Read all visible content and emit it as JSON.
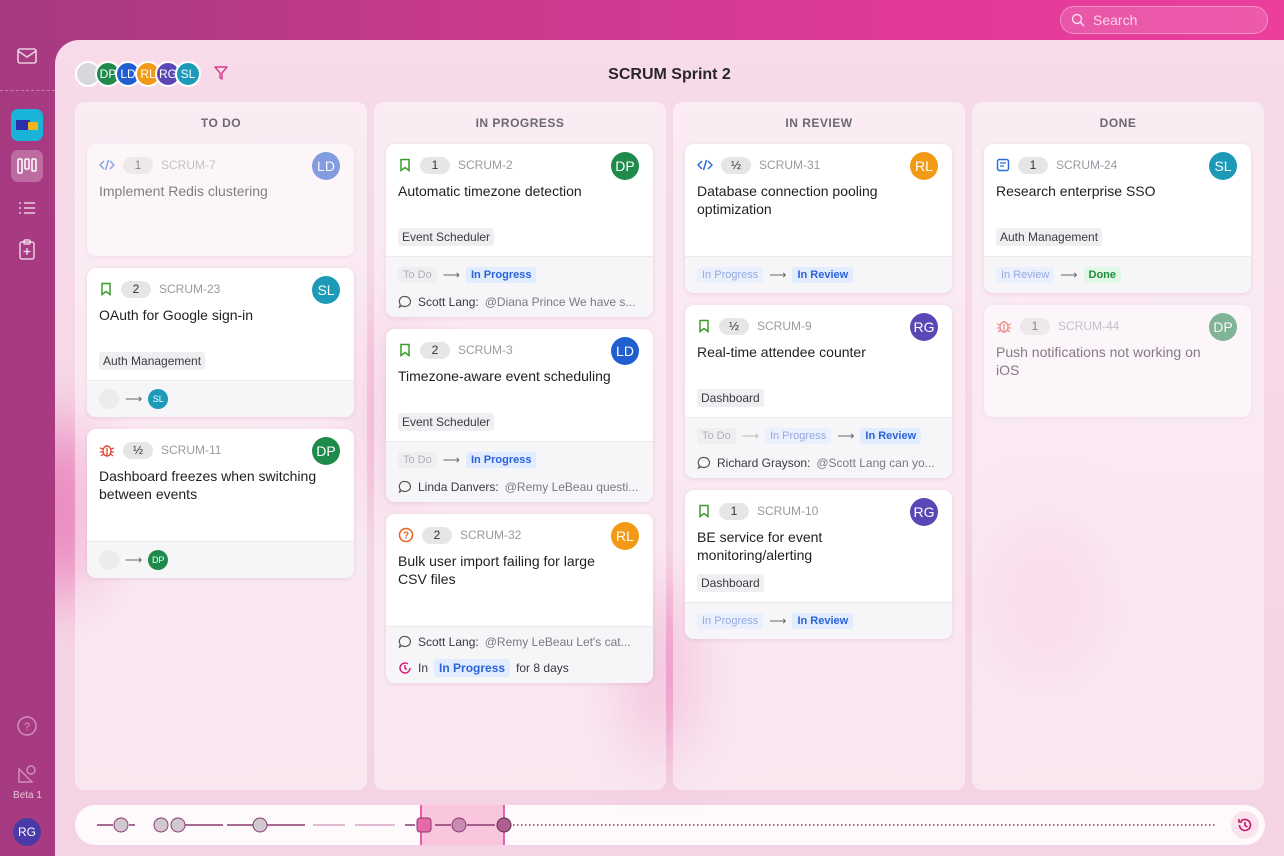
{
  "search": {
    "placeholder": "Search"
  },
  "sidebar": {
    "beta_label": "Beta 1",
    "user_initials": "RG"
  },
  "board": {
    "title": "SCRUM Sprint 2",
    "members": [
      {
        "initials": "",
        "color": "#d8d8dc"
      },
      {
        "initials": "DP",
        "color": "#1e8a4c"
      },
      {
        "initials": "LD",
        "color": "#1f5fd1"
      },
      {
        "initials": "RL",
        "color": "#f29a16"
      },
      {
        "initials": "RG",
        "color": "#5a47b5"
      },
      {
        "initials": "SL",
        "color": "#1d9ab8"
      }
    ]
  },
  "columns": [
    {
      "title": "TO DO",
      "cards": [
        {
          "type": "code-icon",
          "points": "1",
          "key": "SCRUM-7",
          "title": "Implement Redis clustering",
          "tag": "",
          "avatar": {
            "initials": "LD",
            "color": "#1f5fd1"
          },
          "faded": true
        },
        {
          "type": "bookmark-icon",
          "points": "2",
          "key": "SCRUM-23",
          "title": "OAuth for Google sign-in",
          "tag": "Auth Management",
          "avatar": {
            "initials": "SL",
            "color": "#1d9ab8"
          },
          "assign_to": "SL",
          "assign_color": "#1d9ab8"
        },
        {
          "type": "bug-icon",
          "points": "½",
          "key": "SCRUM-11",
          "title": "Dashboard freezes when switching between events",
          "tag": "",
          "avatar": {
            "initials": "DP",
            "color": "#1e8a4c"
          },
          "assign_to": "DP",
          "assign_color": "#1e8a4c"
        }
      ]
    },
    {
      "title": "IN PROGRESS",
      "cards": [
        {
          "type": "bookmark-icon",
          "points": "1",
          "key": "SCRUM-2",
          "title": "Automatic timezone detection",
          "tag": "Event Scheduler",
          "avatar": {
            "initials": "DP",
            "color": "#1e8a4c"
          },
          "from": "To Do",
          "to": "In Progress",
          "comment_author": "Scott Lang:",
          "comment_text": "@Diana Prince We have s..."
        },
        {
          "type": "bookmark-icon",
          "points": "2",
          "key": "SCRUM-3",
          "title": "Timezone-aware event scheduling",
          "tag": "Event Scheduler",
          "avatar": {
            "initials": "LD",
            "color": "#1f5fd1"
          },
          "from": "To Do",
          "to": "In Progress",
          "comment_author": "Linda Danvers:",
          "comment_text": "@Remy LeBeau questi..."
        },
        {
          "type": "question-icon",
          "points": "2",
          "key": "SCRUM-32",
          "title": "Bulk user import failing for large CSV files",
          "tag": "",
          "avatar": {
            "initials": "RL",
            "color": "#f29a16"
          },
          "comment_author": "Scott Lang:",
          "comment_text": "@Remy LeBeau Let's cat...",
          "age_in": "In",
          "age_status": "In Progress",
          "age_days": "for 8 days"
        }
      ]
    },
    {
      "title": "IN REVIEW",
      "cards": [
        {
          "type": "code-icon",
          "points": "½",
          "key": "SCRUM-31",
          "title": "Database connection pooling optimization",
          "tag": "",
          "avatar": {
            "initials": "RL",
            "color": "#f29a16"
          },
          "from": "In Progress",
          "to": "In Review"
        },
        {
          "type": "bookmark-icon",
          "points": "½",
          "key": "SCRUM-9",
          "title": "Real-time attendee counter",
          "tag": "Dashboard",
          "avatar": {
            "initials": "RG",
            "color": "#5a47b5"
          },
          "from0": "To Do",
          "from": "In Progress",
          "to": "In Review",
          "comment_author": "Richard Grayson:",
          "comment_text": "@Scott Lang can yo..."
        },
        {
          "type": "bookmark-icon",
          "points": "1",
          "key": "SCRUM-10",
          "title": "BE service for event monitoring/alerting",
          "tag": "Dashboard",
          "avatar": {
            "initials": "RG",
            "color": "#5a47b5"
          },
          "from": "In Progress",
          "to": "In Review"
        }
      ]
    },
    {
      "title": "DONE",
      "cards": [
        {
          "type": "doc-icon",
          "points": "1",
          "key": "SCRUM-24",
          "title": "Research enterprise SSO",
          "tag": "Auth Management",
          "avatar": {
            "initials": "SL",
            "color": "#1d9ab8"
          },
          "from": "In Review",
          "to": "Done"
        },
        {
          "type": "bug-icon",
          "points": "1",
          "key": "SCRUM-44",
          "title": "Push notifications not working on iOS",
          "tag": "",
          "avatar": {
            "initials": "DP",
            "color": "#1e8a4c"
          },
          "faded": true
        }
      ]
    }
  ]
}
